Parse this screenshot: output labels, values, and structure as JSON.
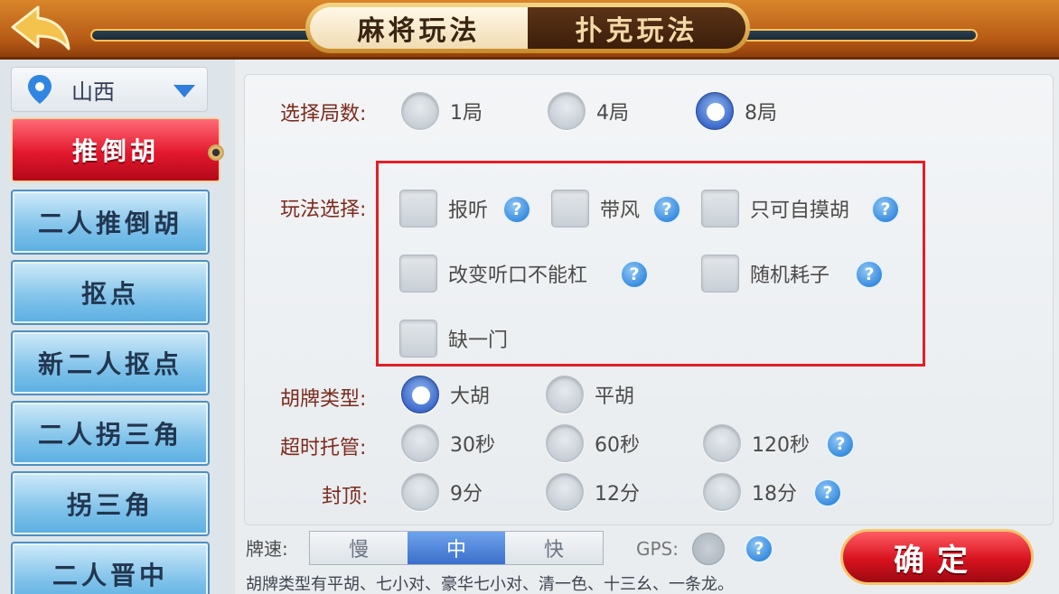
{
  "top": {
    "tabs": [
      {
        "label": "麻将玩法",
        "active": true
      },
      {
        "label": "扑克玩法",
        "active": false
      }
    ]
  },
  "sidebar": {
    "region": "山西",
    "modes": [
      {
        "label": "推倒胡",
        "selected": true
      },
      {
        "label": "二人推倒胡",
        "selected": false
      },
      {
        "label": "抠点",
        "selected": false
      },
      {
        "label": "新二人抠点",
        "selected": false
      },
      {
        "label": "二人拐三角",
        "selected": false
      },
      {
        "label": "拐三角",
        "selected": false
      },
      {
        "label": "二人晋中",
        "selected": false
      }
    ]
  },
  "settings": {
    "rounds": {
      "label": "选择局数:",
      "options": [
        "1局",
        "4局",
        "8局"
      ],
      "selected": "8局"
    },
    "play": {
      "label": "玩法选择:",
      "options": [
        {
          "label": "报听",
          "checked": false
        },
        {
          "label": "带风",
          "checked": false
        },
        {
          "label": "只可自摸胡",
          "checked": false
        },
        {
          "label": "改变听口不能杠",
          "checked": false
        },
        {
          "label": "随机耗子",
          "checked": false
        },
        {
          "label": "缺一门",
          "checked": false
        }
      ]
    },
    "hu_type": {
      "label": "胡牌类型:",
      "options": [
        "大胡",
        "平胡"
      ],
      "selected": "大胡"
    },
    "timeout": {
      "label": "超时托管:",
      "options": [
        "30秒",
        "60秒",
        "120秒"
      ],
      "selected": null
    },
    "cap": {
      "label": "封顶:",
      "options": [
        "9分",
        "12分",
        "18分"
      ],
      "selected": null
    },
    "help_glyph": "?"
  },
  "bottom": {
    "speed_label": "牌速:",
    "speed_options": [
      "慢",
      "中",
      "快"
    ],
    "speed_selected": "中",
    "gps_label": "GPS:",
    "confirm_label": "确定",
    "note": "胡牌类型有平胡、七小对、豪华七小对、清一色、十三幺、一条龙。"
  },
  "colors": {
    "accent_red": "#e21f26",
    "selected_blue": "#3f6ccd",
    "label_red": "#7d2a1c"
  }
}
